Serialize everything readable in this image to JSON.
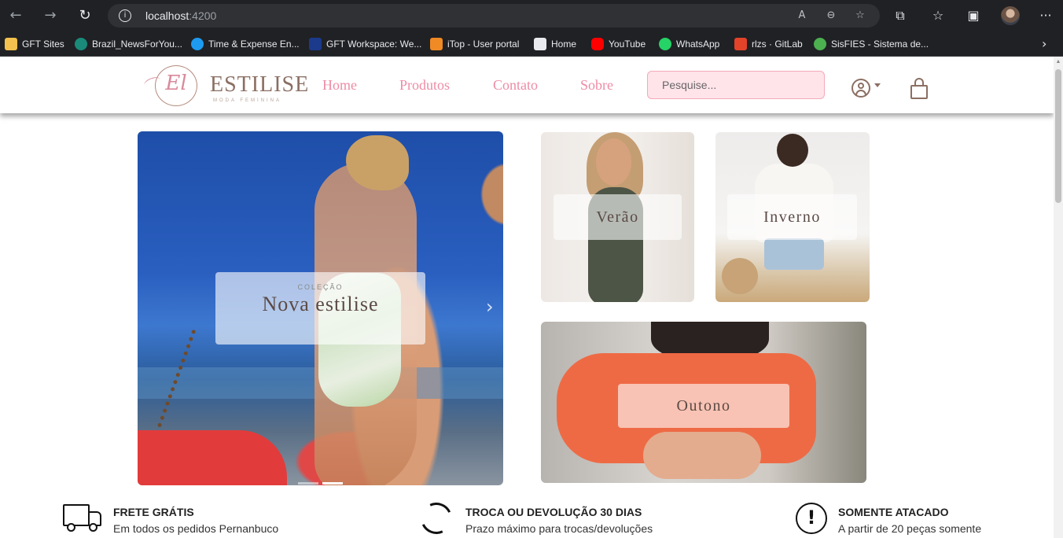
{
  "browser": {
    "url_host": "localhost",
    "url_port": ":4200",
    "back_glyph": "←",
    "forward_glyph": "→",
    "reload_glyph": "↻",
    "info_glyph": "i",
    "read_aloud_glyph": "A",
    "zoom_glyph": "⊖",
    "favorite_glyph": "☆",
    "extensions_glyph": "⧉",
    "favorites_glyph": "☆",
    "collections_glyph": "▣",
    "more_glyph": "···",
    "bookmark_more_glyph": "›"
  },
  "bookmarks": [
    {
      "label": "GFT Sites",
      "icon": "folder-icon",
      "color": "#f2c14e"
    },
    {
      "label": "Brazil_NewsForYou...",
      "icon": "sharepoint-icon",
      "color": "#1a8a7a"
    },
    {
      "label": "Time & Expense En...",
      "icon": "cloud-icon",
      "color": "#1d9bf0"
    },
    {
      "label": "GFT Workspace: We...",
      "icon": "workspace-icon",
      "color": "#1b3a8c"
    },
    {
      "label": "iTop - User portal",
      "icon": "itop-icon",
      "color": "#f08a24"
    },
    {
      "label": "Home",
      "icon": "home-icon",
      "color": "#e8eaed"
    },
    {
      "label": "YouTube",
      "icon": "youtube-icon",
      "color": "#ff0000"
    },
    {
      "label": "WhatsApp",
      "icon": "whatsapp-icon",
      "color": "#25d366"
    },
    {
      "label": "rlzs · GitLab",
      "icon": "gitlab-icon",
      "color": "#e24329"
    },
    {
      "label": "SisFIES - Sistema de...",
      "icon": "sisfies-icon",
      "color": "#4caf50"
    }
  ],
  "site": {
    "logo_monogram": "El",
    "logo_name": "ESTILISE",
    "logo_tagline": "MODA FEMININA",
    "nav": [
      "Home",
      "Produtos",
      "Contato",
      "Sobre"
    ],
    "search_placeholder": "Pesquise...",
    "accent_color": "#ee8ca6",
    "brand_color": "#8b6f63"
  },
  "hero": {
    "kicker": "COLEÇÃO",
    "title": "Nova estilise",
    "next_glyph": "›",
    "slide_count": 2,
    "active_slide": 2
  },
  "categories": [
    {
      "label": "Verão"
    },
    {
      "label": "Inverno"
    },
    {
      "label": "Outono"
    }
  ],
  "features": [
    {
      "title": "FRETE GRÁTIS",
      "subtitle": "Em todos os pedidos Pernanbuco",
      "icon": "truck-icon"
    },
    {
      "title": "TROCA OU DEVOLUÇÃO 30 DIAS",
      "subtitle": "Prazo máximo para trocas/devoluções",
      "icon": "exchange-icon"
    },
    {
      "title": "SOMENTE ATACADO",
      "subtitle": "A partir de 20 peças somente",
      "icon": "alert-icon",
      "glyph": "!"
    }
  ]
}
